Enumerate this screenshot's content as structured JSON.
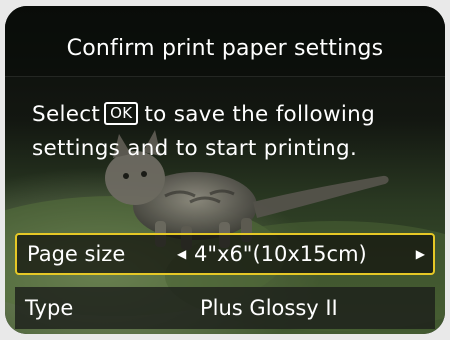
{
  "screen": {
    "title": "Confirm print paper settings",
    "message": {
      "line1_before": "Select",
      "ok_key": "OK",
      "line1_after": "to save the following",
      "line2": "settings and to start printing."
    }
  },
  "settings": {
    "page_size": {
      "label": "Page size",
      "value": "4\"x6\"(10x15cm)",
      "left_arrow": "◀",
      "right_arrow": "▶",
      "selected": true
    },
    "type": {
      "label": "Type",
      "value": "Plus Glossy II"
    }
  },
  "colors": {
    "selection_border": "#e6c826",
    "text": "#ffffff"
  },
  "icons": {
    "left_arrow": "triangle-left-icon",
    "right_arrow": "triangle-right-icon",
    "background_photo": "kitten-on-grass-photo"
  }
}
